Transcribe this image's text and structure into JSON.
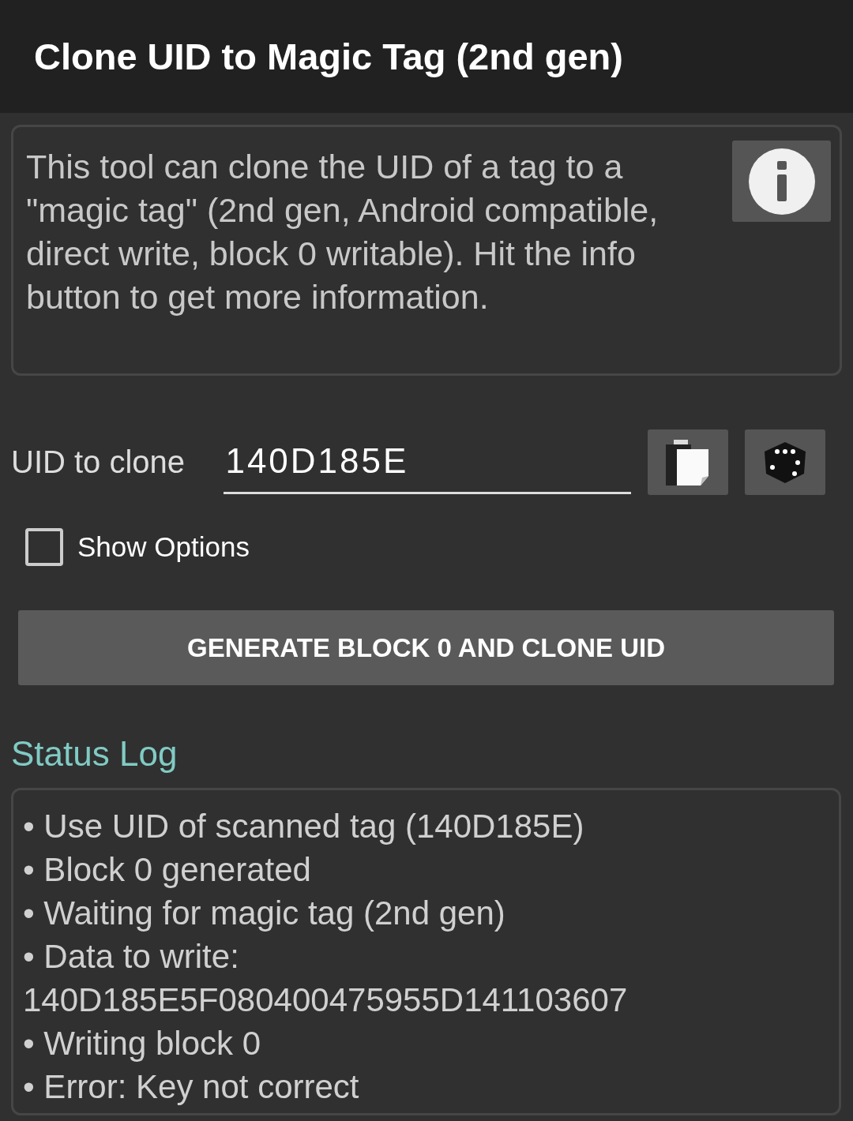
{
  "window": {
    "title": "Clone UID to Magic Tag (2nd gen)"
  },
  "description": "This tool can clone the UID of a tag to a \"magic tag\" (2nd gen, Android compatible, direct write, block 0 writable). Hit the info button to get more information.",
  "uid": {
    "label": "UID to clone",
    "value": "140D185E"
  },
  "show_options": {
    "label": "Show Options",
    "checked": false
  },
  "action_button": "GENERATE BLOCK 0 AND CLONE UID",
  "status_log": {
    "title": "Status Log",
    "lines": [
      "• Use UID of scanned tag (140D185E)",
      "• Block 0 generated",
      "• Waiting for magic tag (2nd gen)",
      "• Data to write:",
      "140D185E5F080400475955D141103607",
      "• Writing block 0",
      "• Error: Key not correct"
    ]
  }
}
